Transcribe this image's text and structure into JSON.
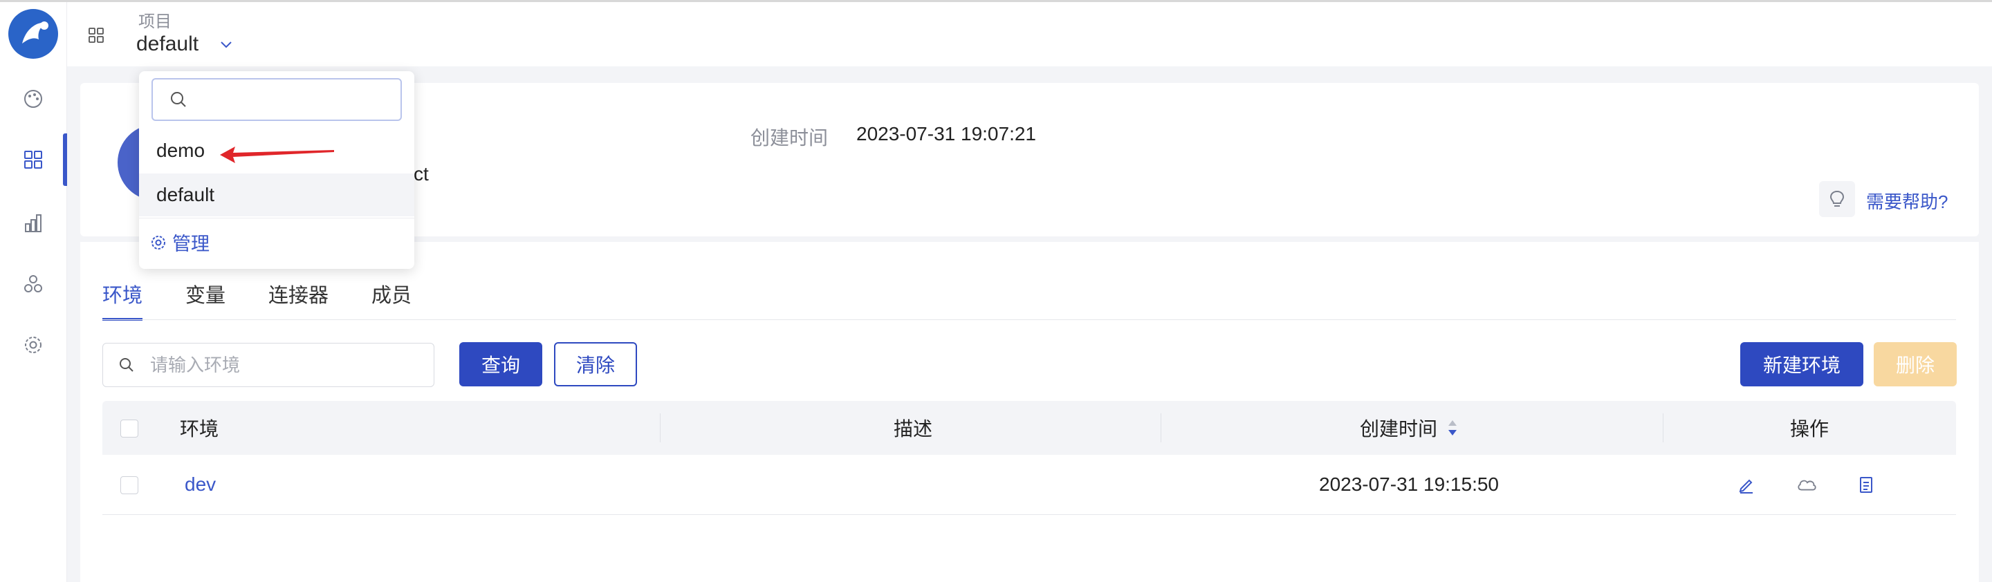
{
  "header": {
    "project_label": "项目",
    "project_value": "default"
  },
  "project_info": {
    "created_label": "创建时间",
    "created_value": "2023-07-31 19:07:21",
    "desc_fragment": "ct"
  },
  "help": {
    "label": "需要帮助?"
  },
  "tabs": [
    {
      "label": "环境",
      "active": true
    },
    {
      "label": "变量",
      "active": false
    },
    {
      "label": "连接器",
      "active": false
    },
    {
      "label": "成员",
      "active": false
    }
  ],
  "search": {
    "placeholder": "请输入环境",
    "query_label": "查询",
    "clear_label": "清除"
  },
  "actions": {
    "new_label": "新建环境",
    "delete_label": "删除"
  },
  "table": {
    "columns": [
      "环境",
      "描述",
      "创建时间",
      "操作"
    ],
    "rows": [
      {
        "env": "dev",
        "description": "",
        "created": "2023-07-31 19:15:50"
      }
    ]
  },
  "dropdown": {
    "search_placeholder": "",
    "items": [
      {
        "label": "demo",
        "selected": false
      },
      {
        "label": "default",
        "selected": true
      }
    ],
    "manage_label": "管理"
  },
  "colors": {
    "accent": "#3a57c9",
    "primary_button": "#2e49c0",
    "disabled_button": "#f8d8a0",
    "annotation_arrow": "#e0262a"
  }
}
